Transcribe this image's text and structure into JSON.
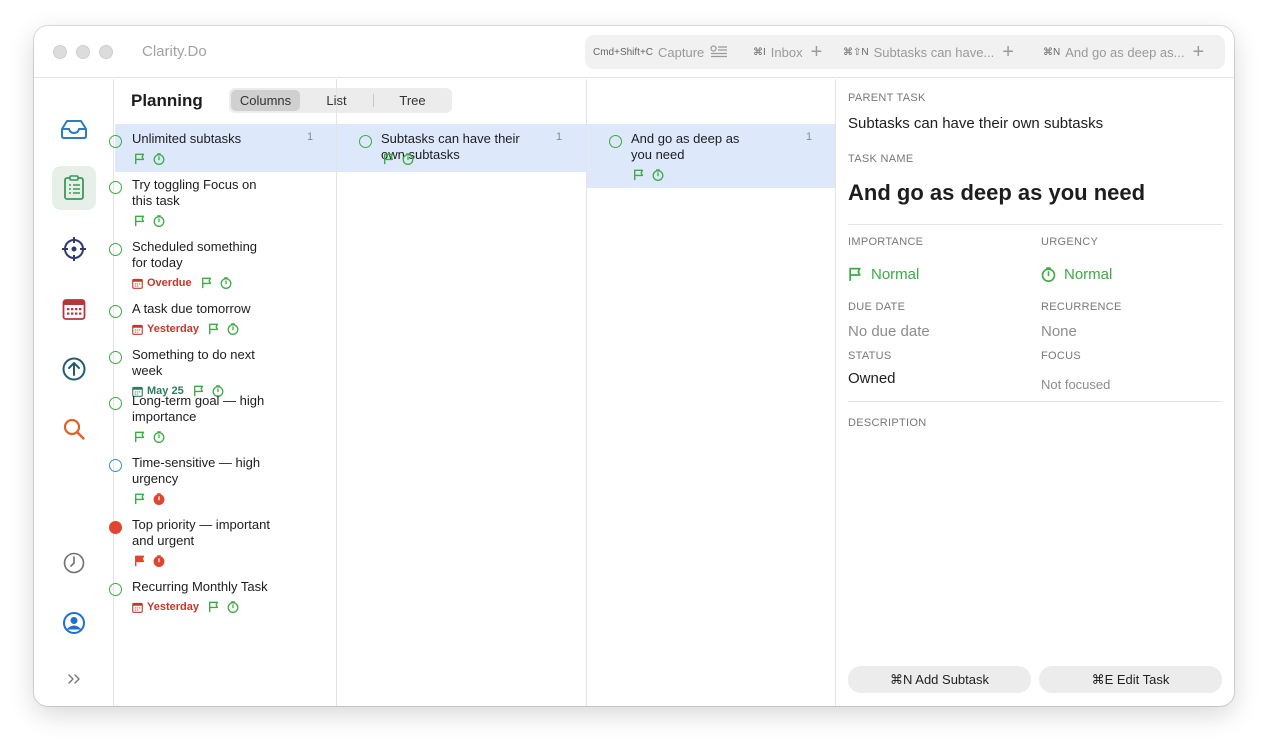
{
  "app": {
    "title": "Clarity.Do"
  },
  "tabs": [
    {
      "shortcut": "Cmd+Shift+C",
      "label": "Capture",
      "icon": "capture-list-icon"
    },
    {
      "shortcut": "⌘I",
      "label": "Inbox",
      "icon": "plus-icon"
    },
    {
      "shortcut": "⌘⇧N",
      "label": "Subtasks can have...",
      "icon": "plus-icon"
    },
    {
      "shortcut": "⌘N",
      "label": "And go as deep as...",
      "icon": "plus-icon"
    }
  ],
  "sidebar": {
    "items": [
      "inbox-icon",
      "clipboard-icon",
      "crosshair-icon",
      "calendar-icon",
      "arrow-up-circle-icon",
      "search-icon"
    ],
    "bottom": [
      "clock-icon",
      "user-icon",
      "chevrons-right-icon"
    ],
    "active": "clipboard-icon"
  },
  "planning": {
    "title": "Planning",
    "views": [
      "Columns",
      "List",
      "Tree"
    ],
    "selected_view": "Columns"
  },
  "columns": [
    {
      "tasks": [
        {
          "title": "Unlimited subtasks",
          "count": "1",
          "status_color": "#3bab43",
          "selected": true,
          "flag": "#3bab43",
          "timer": "#3bab43"
        },
        {
          "title": "Try toggling Focus on this task",
          "status_color": "#3bab43",
          "flag": "#3bab43",
          "timer": "#3bab43"
        },
        {
          "title": "Scheduled something for today",
          "status_color": "#3bab43",
          "date": "Overdue",
          "date_color": "#c0392b",
          "flag": "#3bab43",
          "timer": "#3bab43"
        },
        {
          "title": "A task due tomorrow",
          "status_color": "#3bab43",
          "date": "Yesterday",
          "date_color": "#c0392b",
          "flag": "#3bab43",
          "timer": "#3bab43"
        },
        {
          "title": "Something to do next week",
          "status_color": "#3bab43",
          "date": "May 25",
          "date_color": "#2e7d5b",
          "flag": "#3bab43",
          "timer": "#3bab43"
        },
        {
          "title": "Long-term goal — high importance",
          "status_color": "#3bab43",
          "flag": "#3bab43",
          "timer": "#3bab43"
        },
        {
          "title": "Time-sensitive — high urgency",
          "status_color": "#3a8fd8",
          "flag": "#3bab43",
          "timer": "#e0452f"
        },
        {
          "title": "Top priority — important and urgent",
          "status_color": "#e0452f",
          "flag": "#e0452f",
          "timer": "#e0452f"
        },
        {
          "title": "Recurring Monthly Task",
          "status_color": "#3bab43",
          "date": "Yesterday",
          "date_color": "#c0392b",
          "flag": "#3bab43",
          "timer": "#3bab43"
        }
      ]
    },
    {
      "tasks": [
        {
          "title": "Subtasks can have their own subtasks",
          "count": "1",
          "status_color": "#3bab43",
          "selected": true,
          "flag": "#3bab43",
          "timer": "#3bab43"
        }
      ]
    },
    {
      "tasks": [
        {
          "title": "And go as deep as you need",
          "count": "1",
          "status_color": "#3bab43",
          "selected": true,
          "flag": "#3bab43",
          "timer": "#3bab43"
        }
      ]
    }
  ],
  "detail": {
    "parent_label": "PARENT TASK",
    "parent_value": "Subtasks can have their own subtasks",
    "name_label": "TASK NAME",
    "name_value": "And go as deep as you need",
    "importance_label": "IMPORTANCE",
    "importance_value": "Normal",
    "urgency_label": "URGENCY",
    "urgency_value": "Normal",
    "due_label": "DUE DATE",
    "due_value": "No due date",
    "recurrence_label": "RECURRENCE",
    "recurrence_value": "None",
    "status_label": "STATUS",
    "status_value": "Owned",
    "focus_label": "FOCUS",
    "focus_value": "Not focused",
    "description_label": "DESCRIPTION",
    "add_subtask": "⌘N Add Subtask",
    "edit_task": "⌘E Edit Task"
  },
  "colors": {
    "green": "#3bab43",
    "red": "#e0452f",
    "blue": "#3a8fd8",
    "selected_bg": "#dde8fb"
  }
}
